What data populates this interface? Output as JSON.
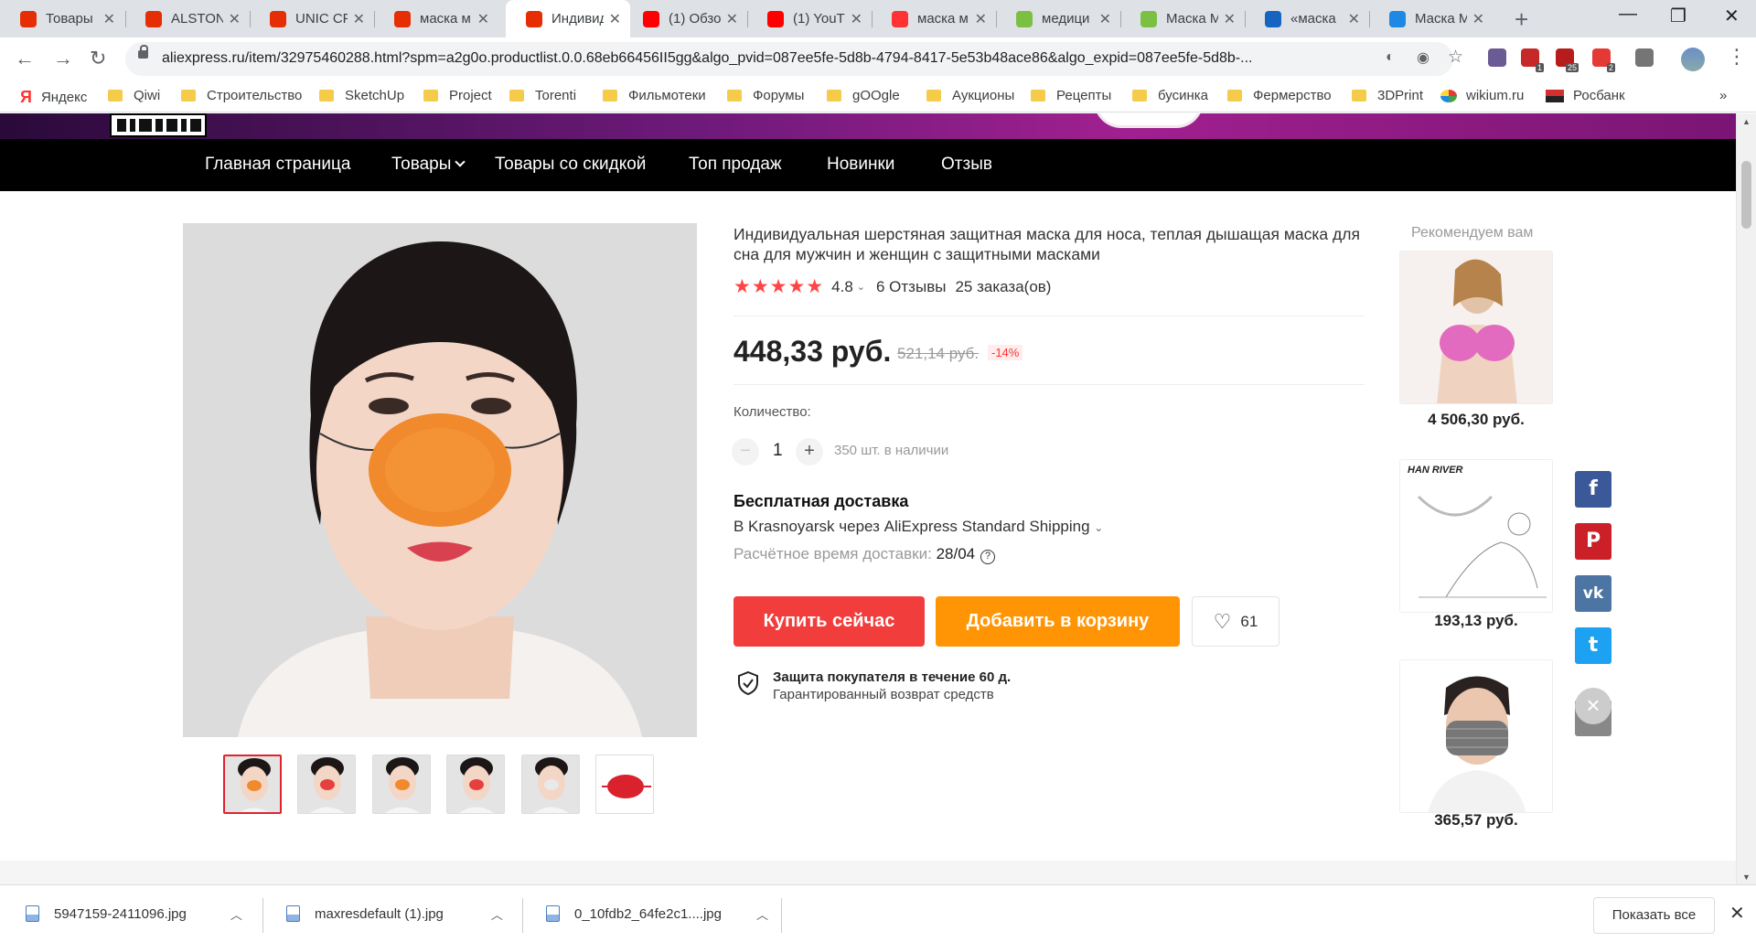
{
  "browser": {
    "tabs": [
      {
        "label": "Товары",
        "favicon": "aliexpress-icon",
        "color": "#e62e04"
      },
      {
        "label": "ALSTON",
        "favicon": "aliexpress-icon",
        "color": "#e62e04"
      },
      {
        "label": "UNIC CP",
        "favicon": "aliexpress-icon",
        "color": "#e62e04"
      },
      {
        "label": "маска м",
        "favicon": "aliexpress-icon",
        "color": "#e62e04"
      },
      {
        "label": "Индивид",
        "favicon": "aliexpress-icon",
        "color": "#e62e04",
        "active": true
      },
      {
        "label": "(1) Обзо",
        "favicon": "youtube-icon",
        "color": "#ff0000"
      },
      {
        "label": "(1) YouT",
        "favicon": "youtube-icon",
        "color": "#ff0000"
      },
      {
        "label": "маска м",
        "favicon": "yandex-icon",
        "color": "#ff3333"
      },
      {
        "label": "медици",
        "favicon": "dots-icon",
        "color": "#7bc043"
      },
      {
        "label": "Маска М",
        "favicon": "dots-icon",
        "color": "#7bc043"
      },
      {
        "label": "«маска",
        "favicon": "cart-icon",
        "color": "#1565c0"
      },
      {
        "label": "Маска М",
        "favicon": "au-icon",
        "color": "#1e88e5"
      }
    ],
    "url": "aliexpress.ru/item/32975460288.html?spm=a2g0o.productlist.0.0.68eb66456II5gg&algo_pvid=087ee5fe-5d8b-4794-8417-5e53b48ace86&algo_expid=087ee5fe-5d8b-...",
    "extensions": [
      {
        "name": "palette-ext-icon",
        "badge": ""
      },
      {
        "name": "adblock-ext-icon",
        "badge": "1"
      },
      {
        "name": "pdf-ext-icon",
        "badge": "25"
      },
      {
        "name": "red-ext-icon",
        "badge": "2"
      },
      {
        "name": "shield-ext-icon",
        "badge": ""
      }
    ],
    "bookmarks": [
      {
        "label": "Яндекс",
        "icon": "yandex-icon"
      },
      {
        "label": "Qiwi",
        "icon": "folder-icon"
      },
      {
        "label": "Строительство",
        "icon": "folder-icon"
      },
      {
        "label": "SketchUp",
        "icon": "folder-icon"
      },
      {
        "label": "Project",
        "icon": "folder-icon"
      },
      {
        "label": "Torenti",
        "icon": "folder-icon"
      },
      {
        "label": "Фильмотеки",
        "icon": "folder-icon"
      },
      {
        "label": "Форумы",
        "icon": "folder-icon"
      },
      {
        "label": "gOOgle",
        "icon": "folder-icon"
      },
      {
        "label": "Аукционы",
        "icon": "folder-icon"
      },
      {
        "label": "Рецепты",
        "icon": "folder-icon"
      },
      {
        "label": "бусинка",
        "icon": "folder-icon"
      },
      {
        "label": "Фермерство",
        "icon": "folder-icon"
      },
      {
        "label": "3DPrint",
        "icon": "folder-icon"
      },
      {
        "label": "wikium.ru",
        "icon": "wikium-icon"
      },
      {
        "label": "Росбанк",
        "icon": "rosbank-icon"
      }
    ],
    "bookmarks_more": "»"
  },
  "nav": {
    "items": [
      "Главная страница",
      "Товары",
      "Товары со скидкой",
      "Топ продаж",
      "Новинки",
      "Отзыв"
    ]
  },
  "product": {
    "title": "Индивидуальная шерстяная защитная маска для носа, теплая дышащая маска для сна для мужчин и женщин с защитными масками",
    "rating": "4.8",
    "stars_filled": 5,
    "reviews": "6 Отзывы",
    "orders": "25 заказа(ов)",
    "price": "448,33 руб.",
    "old_price": "521,14 руб.",
    "discount": "-14%",
    "quantity_label": "Количество:",
    "quantity": "1",
    "stock": "350 шт. в наличии",
    "shipping_title": "Бесплатная доставка",
    "shipping_method": "В Krasnoyarsk через AliExpress Standard Shipping",
    "delivery_label": "Расчётное время доставки:",
    "delivery_date": "28/04",
    "buy_now": "Купить сейчас",
    "add_to_cart": "Добавить в корзину",
    "wishlist_count": "61",
    "protection_title": "Защита покупателя в течение 60 д.",
    "protection_sub": "Гарантированный возврат средств",
    "thumbnail_count": 6
  },
  "recommend": {
    "label": "Рекомендуем вам",
    "items": [
      {
        "price": "4 506,30 руб."
      },
      {
        "price": "193,13 руб.",
        "brand": "HAN RIVER"
      },
      {
        "price": "365,57 руб."
      }
    ]
  },
  "social": [
    {
      "name": "facebook-icon",
      "glyph": "f",
      "color": "#3b5998"
    },
    {
      "name": "pinterest-icon",
      "glyph": "P",
      "color": "#cb2027"
    },
    {
      "name": "vk-icon",
      "glyph": "vk",
      "color": "#4c75a3"
    },
    {
      "name": "twitter-icon",
      "glyph": "t",
      "color": "#1da1f2"
    },
    {
      "name": "edit-icon",
      "glyph": "✎",
      "color": "#888888"
    }
  ],
  "downloads": {
    "files": [
      "5947159-2411096.jpg",
      "maxresdefault (1).jpg",
      "0_10fdb2_64fe2c1....jpg"
    ],
    "show_all": "Показать все"
  }
}
